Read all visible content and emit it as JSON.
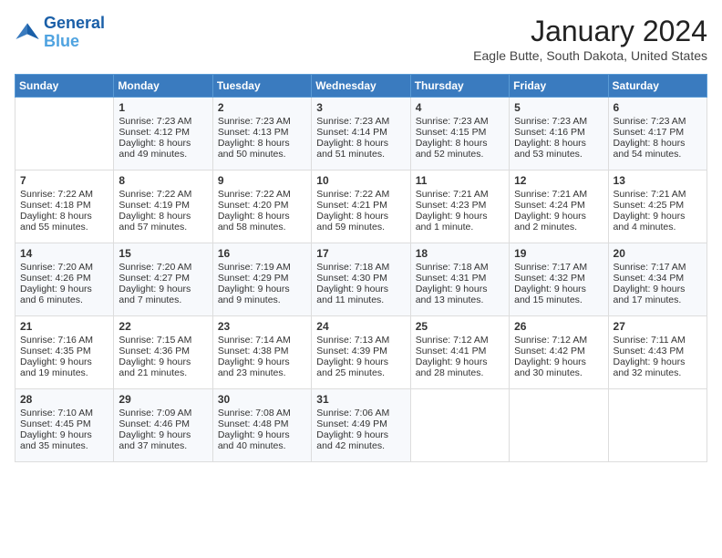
{
  "header": {
    "logo_line1": "General",
    "logo_line2": "Blue",
    "title": "January 2024",
    "subtitle": "Eagle Butte, South Dakota, United States"
  },
  "days_of_week": [
    "Sunday",
    "Monday",
    "Tuesday",
    "Wednesday",
    "Thursday",
    "Friday",
    "Saturday"
  ],
  "weeks": [
    [
      {
        "day": "",
        "sunrise": "",
        "sunset": "",
        "daylight": ""
      },
      {
        "day": "1",
        "sunrise": "Sunrise: 7:23 AM",
        "sunset": "Sunset: 4:12 PM",
        "daylight": "Daylight: 8 hours and 49 minutes."
      },
      {
        "day": "2",
        "sunrise": "Sunrise: 7:23 AM",
        "sunset": "Sunset: 4:13 PM",
        "daylight": "Daylight: 8 hours and 50 minutes."
      },
      {
        "day": "3",
        "sunrise": "Sunrise: 7:23 AM",
        "sunset": "Sunset: 4:14 PM",
        "daylight": "Daylight: 8 hours and 51 minutes."
      },
      {
        "day": "4",
        "sunrise": "Sunrise: 7:23 AM",
        "sunset": "Sunset: 4:15 PM",
        "daylight": "Daylight: 8 hours and 52 minutes."
      },
      {
        "day": "5",
        "sunrise": "Sunrise: 7:23 AM",
        "sunset": "Sunset: 4:16 PM",
        "daylight": "Daylight: 8 hours and 53 minutes."
      },
      {
        "day": "6",
        "sunrise": "Sunrise: 7:23 AM",
        "sunset": "Sunset: 4:17 PM",
        "daylight": "Daylight: 8 hours and 54 minutes."
      }
    ],
    [
      {
        "day": "7",
        "sunrise": "Sunrise: 7:22 AM",
        "sunset": "Sunset: 4:18 PM",
        "daylight": "Daylight: 8 hours and 55 minutes."
      },
      {
        "day": "8",
        "sunrise": "Sunrise: 7:22 AM",
        "sunset": "Sunset: 4:19 PM",
        "daylight": "Daylight: 8 hours and 57 minutes."
      },
      {
        "day": "9",
        "sunrise": "Sunrise: 7:22 AM",
        "sunset": "Sunset: 4:20 PM",
        "daylight": "Daylight: 8 hours and 58 minutes."
      },
      {
        "day": "10",
        "sunrise": "Sunrise: 7:22 AM",
        "sunset": "Sunset: 4:21 PM",
        "daylight": "Daylight: 8 hours and 59 minutes."
      },
      {
        "day": "11",
        "sunrise": "Sunrise: 7:21 AM",
        "sunset": "Sunset: 4:23 PM",
        "daylight": "Daylight: 9 hours and 1 minute."
      },
      {
        "day": "12",
        "sunrise": "Sunrise: 7:21 AM",
        "sunset": "Sunset: 4:24 PM",
        "daylight": "Daylight: 9 hours and 2 minutes."
      },
      {
        "day": "13",
        "sunrise": "Sunrise: 7:21 AM",
        "sunset": "Sunset: 4:25 PM",
        "daylight": "Daylight: 9 hours and 4 minutes."
      }
    ],
    [
      {
        "day": "14",
        "sunrise": "Sunrise: 7:20 AM",
        "sunset": "Sunset: 4:26 PM",
        "daylight": "Daylight: 9 hours and 6 minutes."
      },
      {
        "day": "15",
        "sunrise": "Sunrise: 7:20 AM",
        "sunset": "Sunset: 4:27 PM",
        "daylight": "Daylight: 9 hours and 7 minutes."
      },
      {
        "day": "16",
        "sunrise": "Sunrise: 7:19 AM",
        "sunset": "Sunset: 4:29 PM",
        "daylight": "Daylight: 9 hours and 9 minutes."
      },
      {
        "day": "17",
        "sunrise": "Sunrise: 7:18 AM",
        "sunset": "Sunset: 4:30 PM",
        "daylight": "Daylight: 9 hours and 11 minutes."
      },
      {
        "day": "18",
        "sunrise": "Sunrise: 7:18 AM",
        "sunset": "Sunset: 4:31 PM",
        "daylight": "Daylight: 9 hours and 13 minutes."
      },
      {
        "day": "19",
        "sunrise": "Sunrise: 7:17 AM",
        "sunset": "Sunset: 4:32 PM",
        "daylight": "Daylight: 9 hours and 15 minutes."
      },
      {
        "day": "20",
        "sunrise": "Sunrise: 7:17 AM",
        "sunset": "Sunset: 4:34 PM",
        "daylight": "Daylight: 9 hours and 17 minutes."
      }
    ],
    [
      {
        "day": "21",
        "sunrise": "Sunrise: 7:16 AM",
        "sunset": "Sunset: 4:35 PM",
        "daylight": "Daylight: 9 hours and 19 minutes."
      },
      {
        "day": "22",
        "sunrise": "Sunrise: 7:15 AM",
        "sunset": "Sunset: 4:36 PM",
        "daylight": "Daylight: 9 hours and 21 minutes."
      },
      {
        "day": "23",
        "sunrise": "Sunrise: 7:14 AM",
        "sunset": "Sunset: 4:38 PM",
        "daylight": "Daylight: 9 hours and 23 minutes."
      },
      {
        "day": "24",
        "sunrise": "Sunrise: 7:13 AM",
        "sunset": "Sunset: 4:39 PM",
        "daylight": "Daylight: 9 hours and 25 minutes."
      },
      {
        "day": "25",
        "sunrise": "Sunrise: 7:12 AM",
        "sunset": "Sunset: 4:41 PM",
        "daylight": "Daylight: 9 hours and 28 minutes."
      },
      {
        "day": "26",
        "sunrise": "Sunrise: 7:12 AM",
        "sunset": "Sunset: 4:42 PM",
        "daylight": "Daylight: 9 hours and 30 minutes."
      },
      {
        "day": "27",
        "sunrise": "Sunrise: 7:11 AM",
        "sunset": "Sunset: 4:43 PM",
        "daylight": "Daylight: 9 hours and 32 minutes."
      }
    ],
    [
      {
        "day": "28",
        "sunrise": "Sunrise: 7:10 AM",
        "sunset": "Sunset: 4:45 PM",
        "daylight": "Daylight: 9 hours and 35 minutes."
      },
      {
        "day": "29",
        "sunrise": "Sunrise: 7:09 AM",
        "sunset": "Sunset: 4:46 PM",
        "daylight": "Daylight: 9 hours and 37 minutes."
      },
      {
        "day": "30",
        "sunrise": "Sunrise: 7:08 AM",
        "sunset": "Sunset: 4:48 PM",
        "daylight": "Daylight: 9 hours and 40 minutes."
      },
      {
        "day": "31",
        "sunrise": "Sunrise: 7:06 AM",
        "sunset": "Sunset: 4:49 PM",
        "daylight": "Daylight: 9 hours and 42 minutes."
      },
      {
        "day": "",
        "sunrise": "",
        "sunset": "",
        "daylight": ""
      },
      {
        "day": "",
        "sunrise": "",
        "sunset": "",
        "daylight": ""
      },
      {
        "day": "",
        "sunrise": "",
        "sunset": "",
        "daylight": ""
      }
    ]
  ]
}
